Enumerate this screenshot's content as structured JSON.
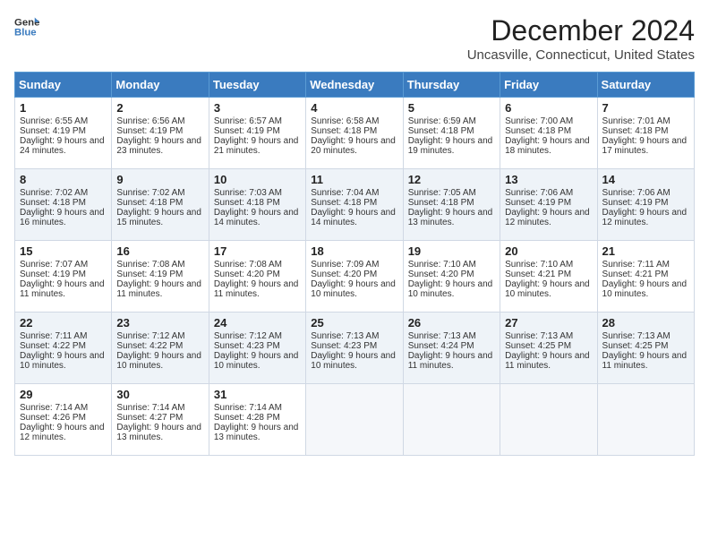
{
  "logo": {
    "line1": "General",
    "line2": "Blue"
  },
  "title": "December 2024",
  "location": "Uncasville, Connecticut, United States",
  "days_of_week": [
    "Sunday",
    "Monday",
    "Tuesday",
    "Wednesday",
    "Thursday",
    "Friday",
    "Saturday"
  ],
  "weeks": [
    [
      {
        "day": "1",
        "sunrise": "Sunrise: 6:55 AM",
        "sunset": "Sunset: 4:19 PM",
        "daylight": "Daylight: 9 hours and 24 minutes."
      },
      {
        "day": "2",
        "sunrise": "Sunrise: 6:56 AM",
        "sunset": "Sunset: 4:19 PM",
        "daylight": "Daylight: 9 hours and 23 minutes."
      },
      {
        "day": "3",
        "sunrise": "Sunrise: 6:57 AM",
        "sunset": "Sunset: 4:19 PM",
        "daylight": "Daylight: 9 hours and 21 minutes."
      },
      {
        "day": "4",
        "sunrise": "Sunrise: 6:58 AM",
        "sunset": "Sunset: 4:18 PM",
        "daylight": "Daylight: 9 hours and 20 minutes."
      },
      {
        "day": "5",
        "sunrise": "Sunrise: 6:59 AM",
        "sunset": "Sunset: 4:18 PM",
        "daylight": "Daylight: 9 hours and 19 minutes."
      },
      {
        "day": "6",
        "sunrise": "Sunrise: 7:00 AM",
        "sunset": "Sunset: 4:18 PM",
        "daylight": "Daylight: 9 hours and 18 minutes."
      },
      {
        "day": "7",
        "sunrise": "Sunrise: 7:01 AM",
        "sunset": "Sunset: 4:18 PM",
        "daylight": "Daylight: 9 hours and 17 minutes."
      }
    ],
    [
      {
        "day": "8",
        "sunrise": "Sunrise: 7:02 AM",
        "sunset": "Sunset: 4:18 PM",
        "daylight": "Daylight: 9 hours and 16 minutes."
      },
      {
        "day": "9",
        "sunrise": "Sunrise: 7:02 AM",
        "sunset": "Sunset: 4:18 PM",
        "daylight": "Daylight: 9 hours and 15 minutes."
      },
      {
        "day": "10",
        "sunrise": "Sunrise: 7:03 AM",
        "sunset": "Sunset: 4:18 PM",
        "daylight": "Daylight: 9 hours and 14 minutes."
      },
      {
        "day": "11",
        "sunrise": "Sunrise: 7:04 AM",
        "sunset": "Sunset: 4:18 PM",
        "daylight": "Daylight: 9 hours and 14 minutes."
      },
      {
        "day": "12",
        "sunrise": "Sunrise: 7:05 AM",
        "sunset": "Sunset: 4:18 PM",
        "daylight": "Daylight: 9 hours and 13 minutes."
      },
      {
        "day": "13",
        "sunrise": "Sunrise: 7:06 AM",
        "sunset": "Sunset: 4:19 PM",
        "daylight": "Daylight: 9 hours and 12 minutes."
      },
      {
        "day": "14",
        "sunrise": "Sunrise: 7:06 AM",
        "sunset": "Sunset: 4:19 PM",
        "daylight": "Daylight: 9 hours and 12 minutes."
      }
    ],
    [
      {
        "day": "15",
        "sunrise": "Sunrise: 7:07 AM",
        "sunset": "Sunset: 4:19 PM",
        "daylight": "Daylight: 9 hours and 11 minutes."
      },
      {
        "day": "16",
        "sunrise": "Sunrise: 7:08 AM",
        "sunset": "Sunset: 4:19 PM",
        "daylight": "Daylight: 9 hours and 11 minutes."
      },
      {
        "day": "17",
        "sunrise": "Sunrise: 7:08 AM",
        "sunset": "Sunset: 4:20 PM",
        "daylight": "Daylight: 9 hours and 11 minutes."
      },
      {
        "day": "18",
        "sunrise": "Sunrise: 7:09 AM",
        "sunset": "Sunset: 4:20 PM",
        "daylight": "Daylight: 9 hours and 10 minutes."
      },
      {
        "day": "19",
        "sunrise": "Sunrise: 7:10 AM",
        "sunset": "Sunset: 4:20 PM",
        "daylight": "Daylight: 9 hours and 10 minutes."
      },
      {
        "day": "20",
        "sunrise": "Sunrise: 7:10 AM",
        "sunset": "Sunset: 4:21 PM",
        "daylight": "Daylight: 9 hours and 10 minutes."
      },
      {
        "day": "21",
        "sunrise": "Sunrise: 7:11 AM",
        "sunset": "Sunset: 4:21 PM",
        "daylight": "Daylight: 9 hours and 10 minutes."
      }
    ],
    [
      {
        "day": "22",
        "sunrise": "Sunrise: 7:11 AM",
        "sunset": "Sunset: 4:22 PM",
        "daylight": "Daylight: 9 hours and 10 minutes."
      },
      {
        "day": "23",
        "sunrise": "Sunrise: 7:12 AM",
        "sunset": "Sunset: 4:22 PM",
        "daylight": "Daylight: 9 hours and 10 minutes."
      },
      {
        "day": "24",
        "sunrise": "Sunrise: 7:12 AM",
        "sunset": "Sunset: 4:23 PM",
        "daylight": "Daylight: 9 hours and 10 minutes."
      },
      {
        "day": "25",
        "sunrise": "Sunrise: 7:13 AM",
        "sunset": "Sunset: 4:23 PM",
        "daylight": "Daylight: 9 hours and 10 minutes."
      },
      {
        "day": "26",
        "sunrise": "Sunrise: 7:13 AM",
        "sunset": "Sunset: 4:24 PM",
        "daylight": "Daylight: 9 hours and 11 minutes."
      },
      {
        "day": "27",
        "sunrise": "Sunrise: 7:13 AM",
        "sunset": "Sunset: 4:25 PM",
        "daylight": "Daylight: 9 hours and 11 minutes."
      },
      {
        "day": "28",
        "sunrise": "Sunrise: 7:13 AM",
        "sunset": "Sunset: 4:25 PM",
        "daylight": "Daylight: 9 hours and 11 minutes."
      }
    ],
    [
      {
        "day": "29",
        "sunrise": "Sunrise: 7:14 AM",
        "sunset": "Sunset: 4:26 PM",
        "daylight": "Daylight: 9 hours and 12 minutes."
      },
      {
        "day": "30",
        "sunrise": "Sunrise: 7:14 AM",
        "sunset": "Sunset: 4:27 PM",
        "daylight": "Daylight: 9 hours and 13 minutes."
      },
      {
        "day": "31",
        "sunrise": "Sunrise: 7:14 AM",
        "sunset": "Sunset: 4:28 PM",
        "daylight": "Daylight: 9 hours and 13 minutes."
      },
      null,
      null,
      null,
      null
    ]
  ]
}
